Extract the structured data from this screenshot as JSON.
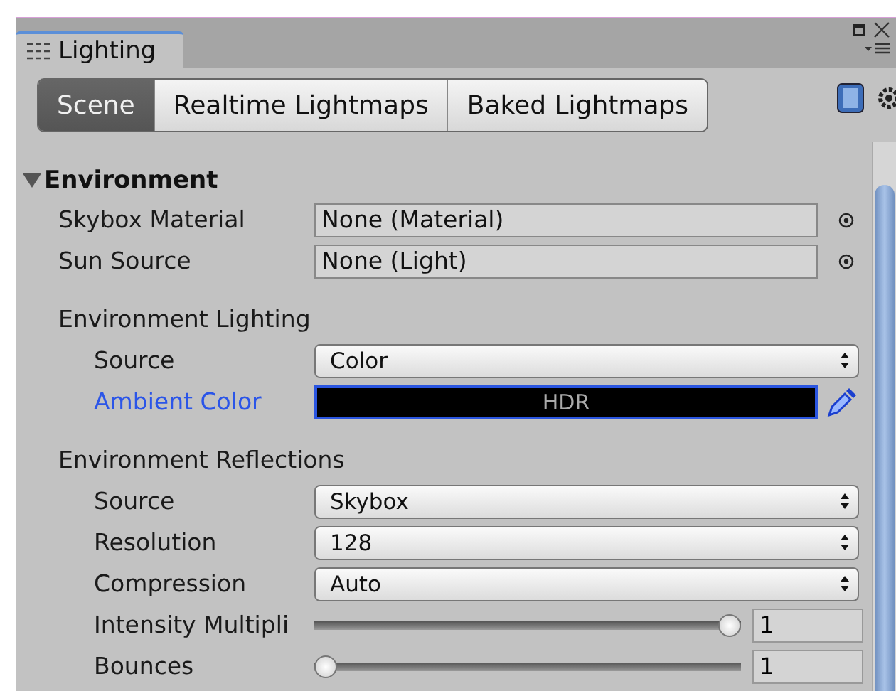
{
  "window": {
    "title": "Lighting"
  },
  "tabs": [
    {
      "label": "Scene",
      "selected": true
    },
    {
      "label": "Realtime Lightmaps",
      "selected": false
    },
    {
      "label": "Baked Lightmaps",
      "selected": false
    }
  ],
  "section": {
    "title": "Environment",
    "expanded": true,
    "items": [
      {
        "kind": "object",
        "label": "Skybox Material",
        "value": "None (Material)"
      },
      {
        "kind": "object",
        "label": "Sun Source",
        "value": "None (Light)"
      },
      {
        "kind": "group",
        "title": "Environment Lighting",
        "items": [
          {
            "kind": "dropdown",
            "label": "Source",
            "value": "Color"
          },
          {
            "kind": "color",
            "label": "Ambient Color",
            "value": "HDR"
          }
        ]
      },
      {
        "kind": "group",
        "title": "Environment Reflections",
        "items": [
          {
            "kind": "dropdown",
            "label": "Source",
            "value": "Skybox"
          },
          {
            "kind": "dropdown",
            "label": "Resolution",
            "value": "128"
          },
          {
            "kind": "dropdown",
            "label": "Compression",
            "value": "Auto"
          },
          {
            "kind": "slider",
            "label": "Intensity Multipli",
            "level": 1,
            "value": "1"
          },
          {
            "kind": "slider",
            "label": "Bounces",
            "level": 0,
            "value": "1"
          }
        ]
      }
    ]
  }
}
